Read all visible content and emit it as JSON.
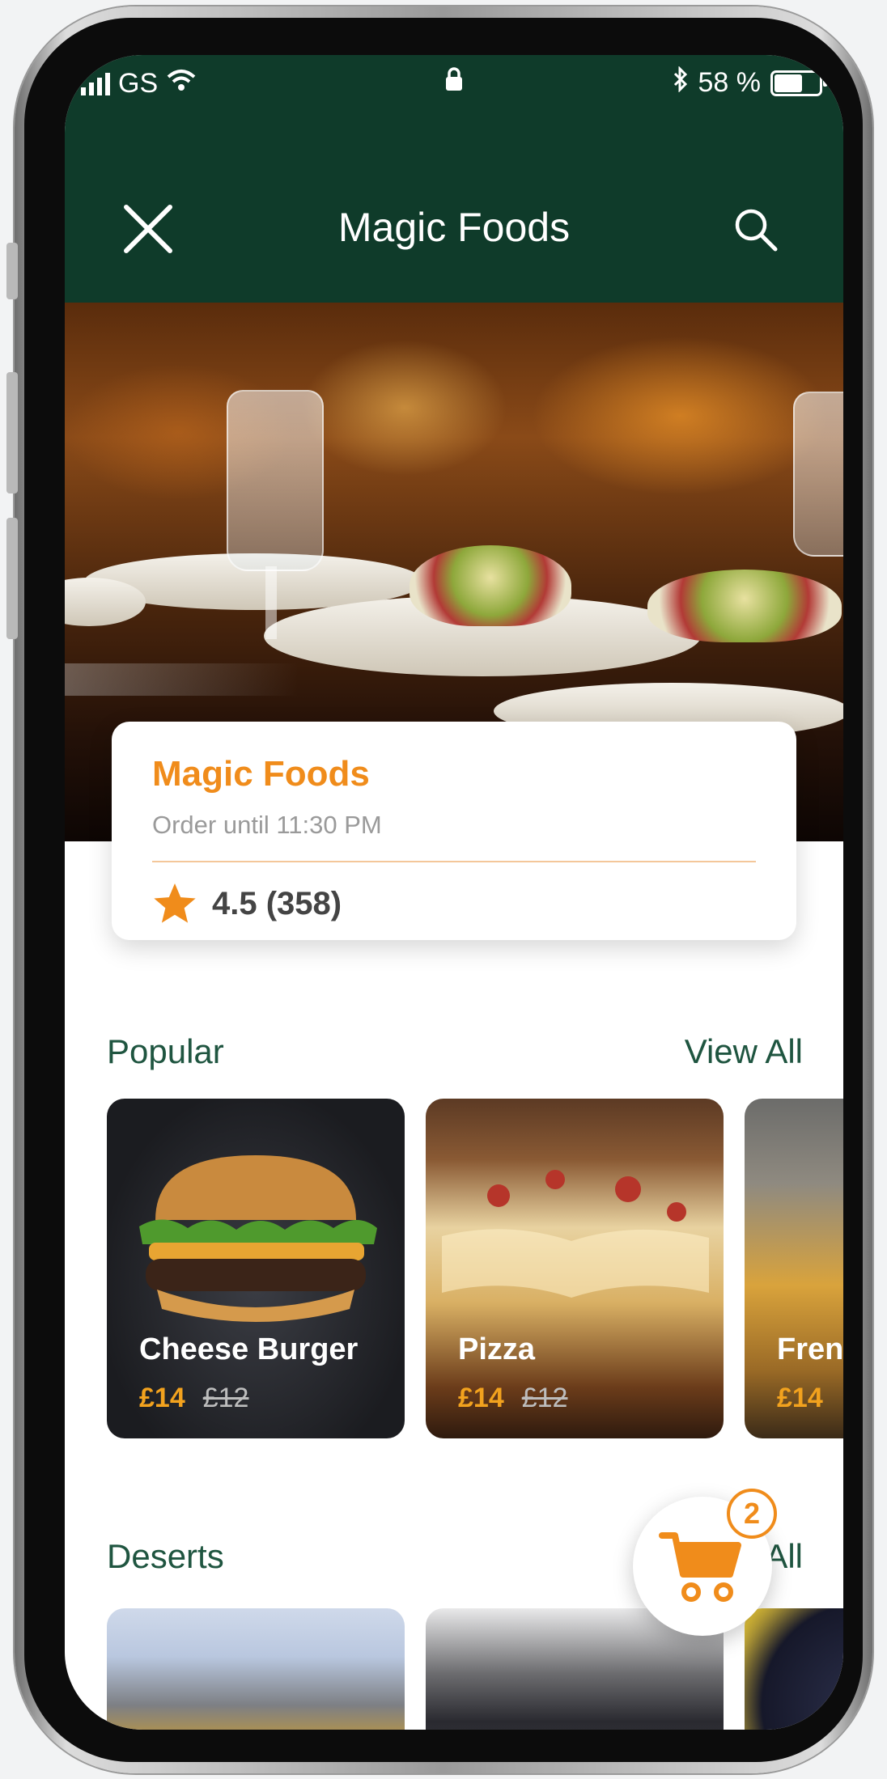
{
  "status_bar": {
    "carrier": "GS",
    "battery": "58 %"
  },
  "header": {
    "title": "Magic Foods"
  },
  "restaurant": {
    "name": "Magic Foods",
    "order_until": "Order until 11:30 PM",
    "rating": "4.5 (358)"
  },
  "popular": {
    "title": "Popular",
    "view_all": "View All",
    "items": [
      {
        "name": "Cheese Burger",
        "price": "£14",
        "old_price": "£12"
      },
      {
        "name": "Pizza",
        "price": "£14",
        "old_price": "£12"
      },
      {
        "name": "Fren",
        "price": "£14"
      }
    ]
  },
  "deserts": {
    "title": "Deserts",
    "view_all": "All"
  },
  "cart": {
    "count": "2"
  },
  "colors": {
    "header_bg": "#0f3b2a",
    "accent_orange": "#f08c1b",
    "section_green": "#1f5540"
  },
  "icons": [
    "signal-icon",
    "wifi-icon",
    "lock-icon",
    "bluetooth-icon",
    "battery-icon",
    "close-icon",
    "search-icon",
    "star-icon",
    "cart-icon"
  ]
}
